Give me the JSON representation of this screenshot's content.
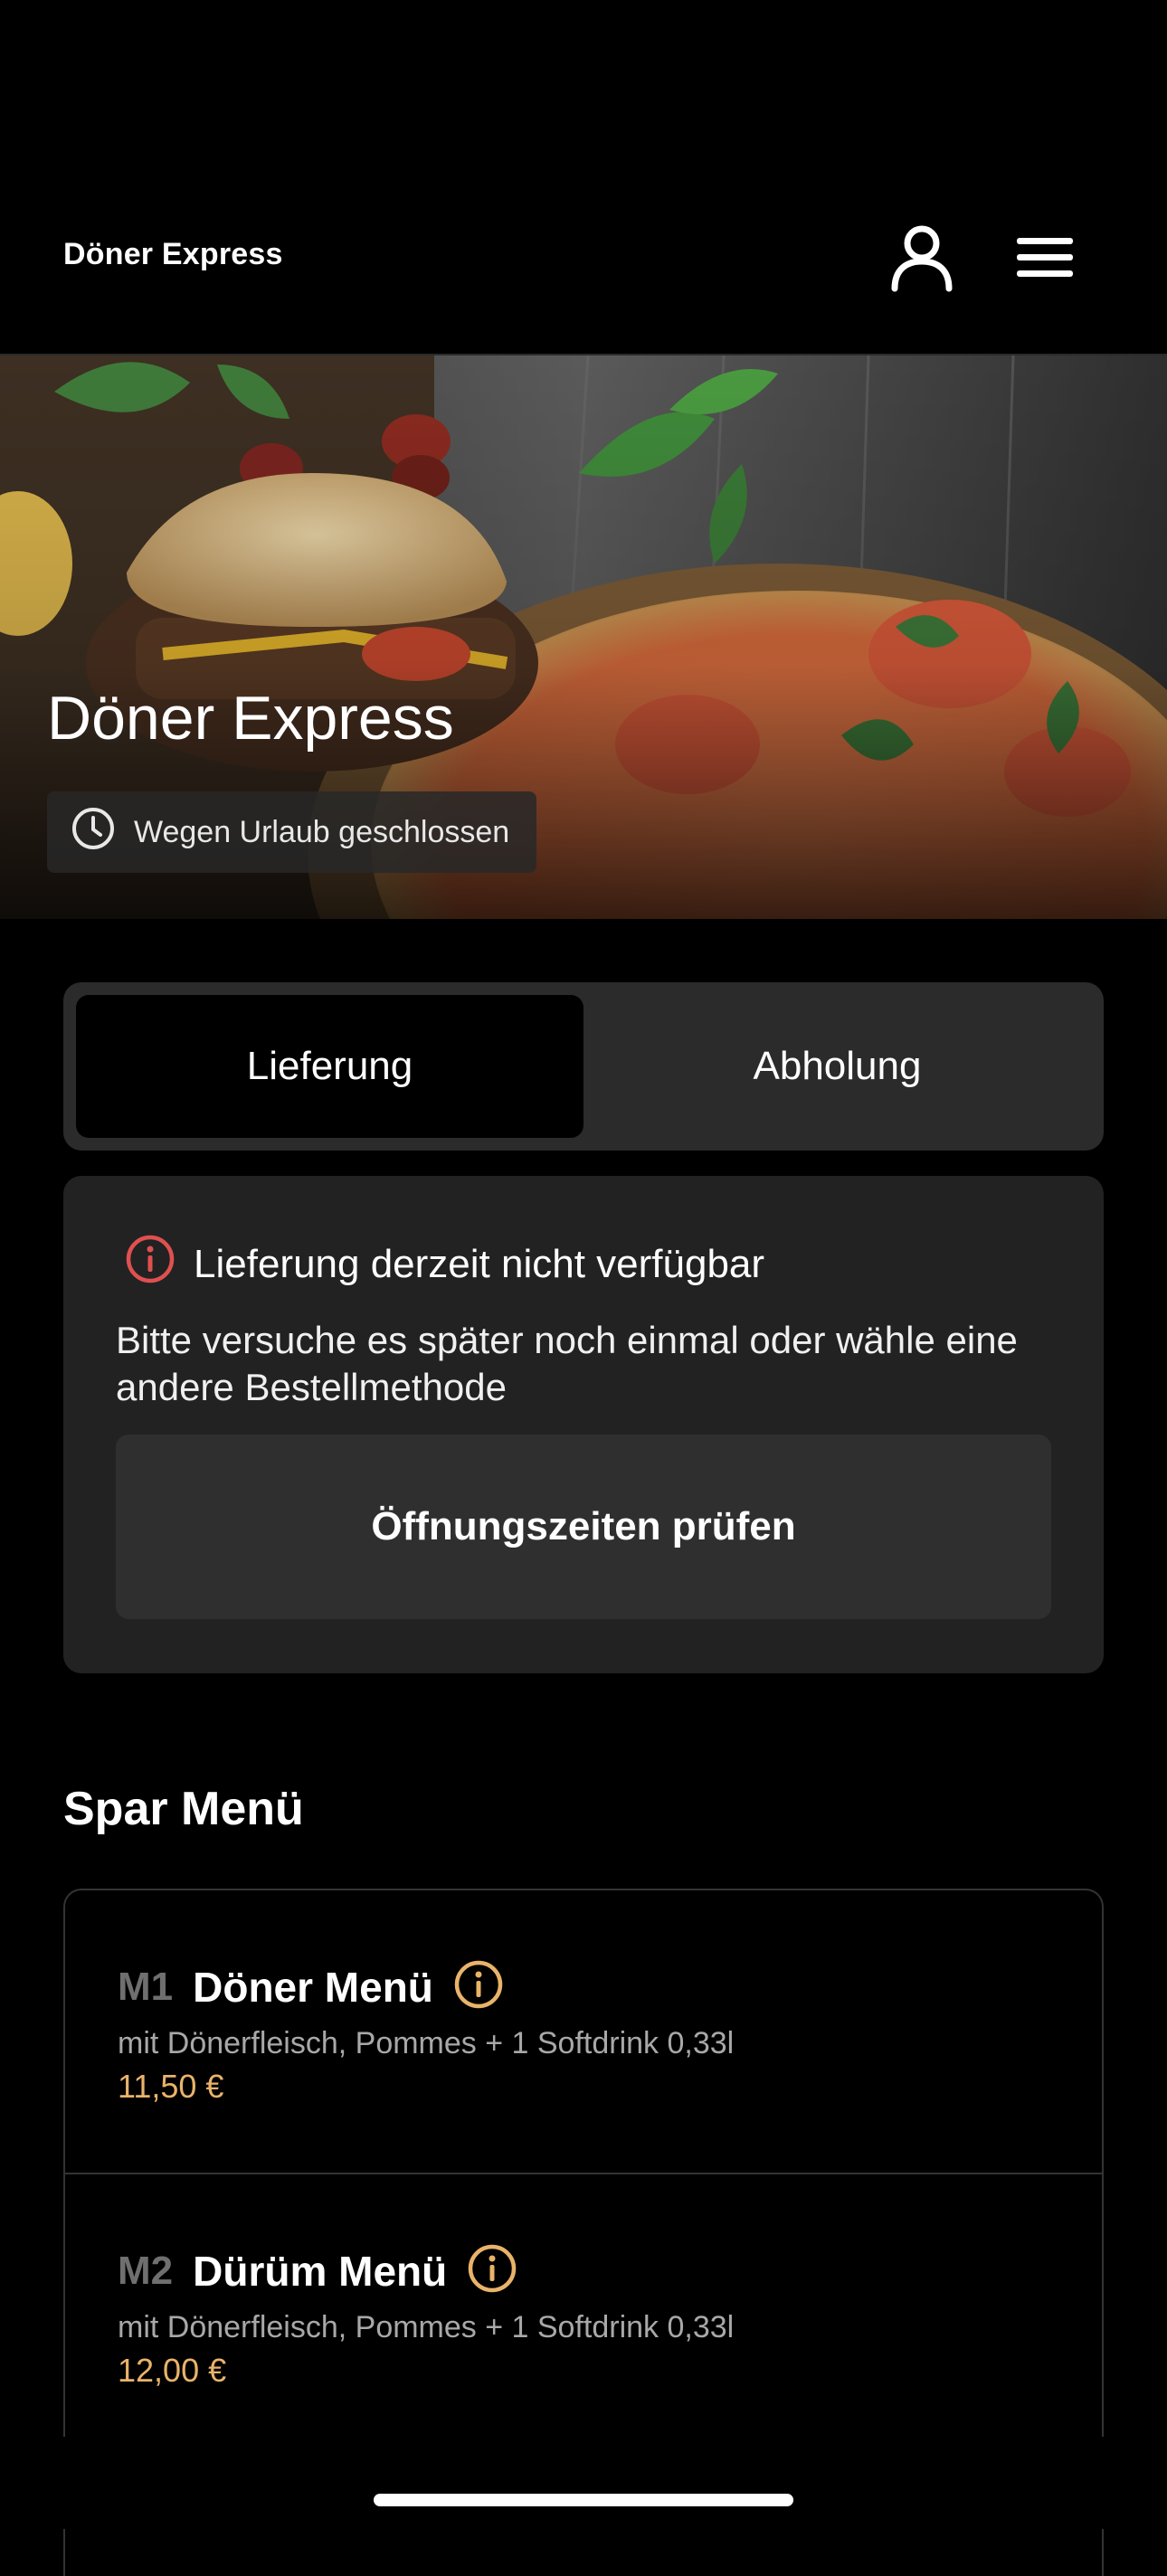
{
  "header": {
    "brand": "Döner Express",
    "icons": [
      "user-icon",
      "hamburger-menu-icon"
    ]
  },
  "hero": {
    "title": "Döner Express",
    "status": "Wegen Urlaub geschlossen"
  },
  "order_mode": {
    "options": [
      {
        "label": "Lieferung",
        "active": true
      },
      {
        "label": "Abholung",
        "active": false
      }
    ]
  },
  "notice": {
    "title": "Lieferung derzeit nicht verfügbar",
    "body": "Bitte versuche es später noch einmal oder wähle eine andere Bestellmethode",
    "button": "Öffnungszeiten prüfen"
  },
  "section": {
    "title": "Spar Menü",
    "items": [
      {
        "code": "M1",
        "name": "Döner Menü",
        "description": "mit Dönerfleisch, Pommes + 1 Softdrink 0,33l",
        "price": "11,50 €"
      },
      {
        "code": "M2",
        "name": "Dürüm Menü",
        "description": "mit Dönerfleisch, Pommes + 1 Softdrink 0,33l",
        "price": "12,00 €"
      }
    ]
  },
  "colors": {
    "background": "#000000",
    "card": "#222222",
    "price": "#e9b36a",
    "info_icon": "#e9b36a",
    "alert_icon": "#e05050"
  }
}
